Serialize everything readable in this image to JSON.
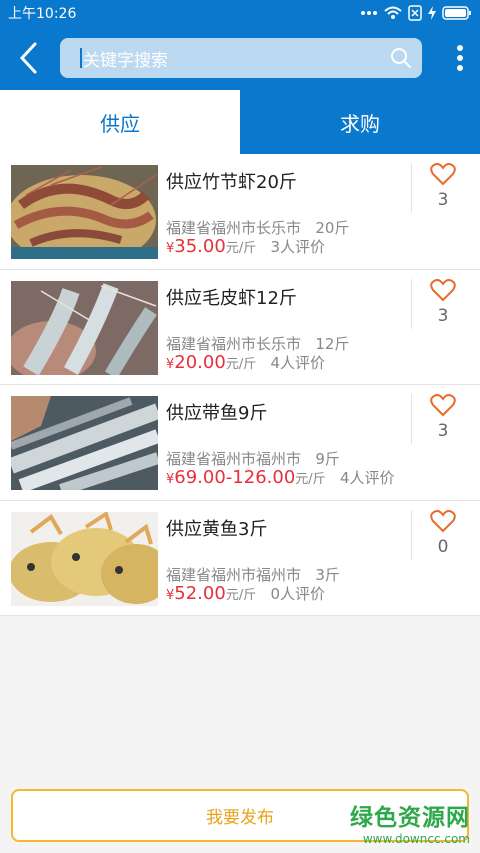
{
  "status_bar": {
    "time": "上午10:26"
  },
  "header": {
    "search_placeholder": "关键字搜索"
  },
  "tabs": [
    {
      "label": "供应",
      "active": true
    },
    {
      "label": "求购",
      "active": false
    }
  ],
  "products": [
    {
      "title": "供应竹节虾20斤",
      "location": "福建省福州市长乐市",
      "qty": "20斤",
      "currency": "¥",
      "price": "35.00",
      "unit": "元/斤",
      "reviews": "3人评价",
      "favorites": "3",
      "image": "shrimp-photo"
    },
    {
      "title": "供应毛皮虾12斤",
      "location": "福建省福州市长乐市",
      "qty": "12斤",
      "currency": "¥",
      "price": "20.00",
      "unit": "元/斤",
      "reviews": "4人评价",
      "favorites": "3",
      "image": "shrimp-photo"
    },
    {
      "title": "供应带鱼9斤",
      "location": "福建省福州市福州市",
      "qty": "9斤",
      "currency": "¥",
      "price": "69.00-126.00",
      "unit": "元/斤",
      "reviews": "4人评价",
      "favorites": "3",
      "image": "hairtail-photo"
    },
    {
      "title": "供应黄鱼3斤",
      "location": "福建省福州市福州市",
      "qty": "3斤",
      "currency": "¥",
      "price": "52.00",
      "unit": "元/斤",
      "reviews": "0人评价",
      "favorites": "0",
      "image": "yellow-croaker-photo"
    }
  ],
  "bottom": {
    "publish_label": "我要发布"
  },
  "watermark": {
    "line1": "绿色资源网",
    "line2": "www.downcc.com"
  },
  "colors": {
    "primary": "#0a78cc",
    "price": "#e8303a",
    "accent": "#f5b82e",
    "heart": "#e86a2a"
  }
}
